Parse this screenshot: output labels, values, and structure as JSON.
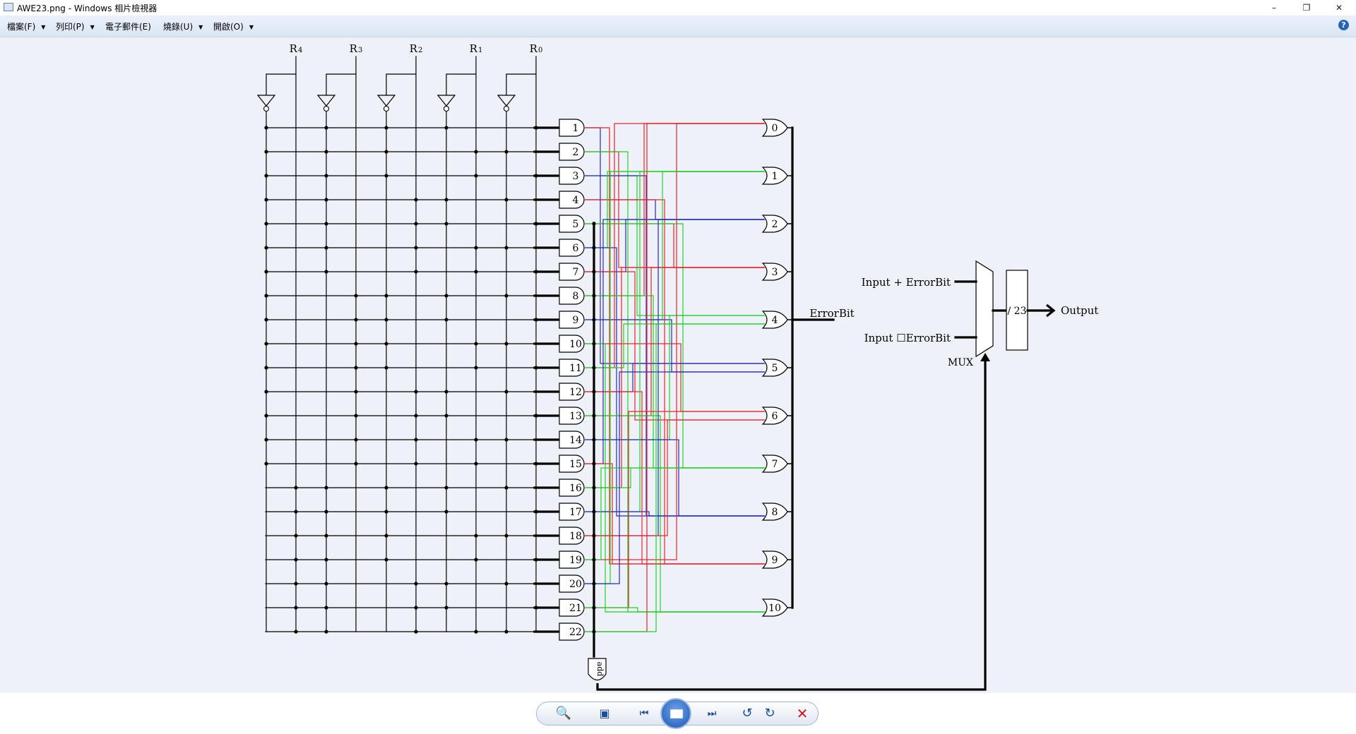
{
  "window": {
    "title": "AWE23.png - Windows 相片檢視器",
    "controls": {
      "minimize": "–",
      "restore": "❐",
      "close": "✕"
    }
  },
  "menubar": {
    "items": [
      {
        "label": "檔案(F)"
      },
      {
        "label": "列印(P)"
      },
      {
        "label": "電子郵件(E)"
      },
      {
        "label": "燒錄(U)"
      },
      {
        "label": "開啟(O)"
      }
    ],
    "help_icon": "?"
  },
  "circuit": {
    "row_labels": [
      "R4",
      "R3",
      "R2",
      "R1",
      "R0"
    ],
    "and_gates": [
      "1",
      "2",
      "3",
      "4",
      "5",
      "6",
      "7",
      "8",
      "9",
      "10",
      "11",
      "12",
      "13",
      "14",
      "15",
      "16",
      "17",
      "18",
      "19",
      "20",
      "21",
      "22"
    ],
    "or_gates": [
      "0",
      "1",
      "2",
      "3",
      "4",
      "5",
      "6",
      "7",
      "8",
      "9",
      "10"
    ],
    "error_bit_label": "ErrorBit",
    "mux_input_top": "Input  + ErrorBit",
    "mux_input_bottom": "Input  ☐ErrorBit",
    "mux_label": "MUX",
    "bus_label": "/ 23",
    "output_label": "Output",
    "add_gate_label": "add",
    "wire_colors": {
      "red": "#e8262b",
      "green": "#22d02a",
      "blue": "#2929b8",
      "black": "#000000"
    }
  },
  "toolbar": {
    "zoom_icon": "magnifier-icon",
    "fit_icon": "fit-window-icon",
    "prev_icon": "previous-icon",
    "slideshow_icon": "slideshow-icon",
    "next_icon": "next-icon",
    "rotate_ccw_icon": "rotate-left-icon",
    "rotate_cw_icon": "rotate-right-icon",
    "delete_icon": "delete-icon"
  }
}
